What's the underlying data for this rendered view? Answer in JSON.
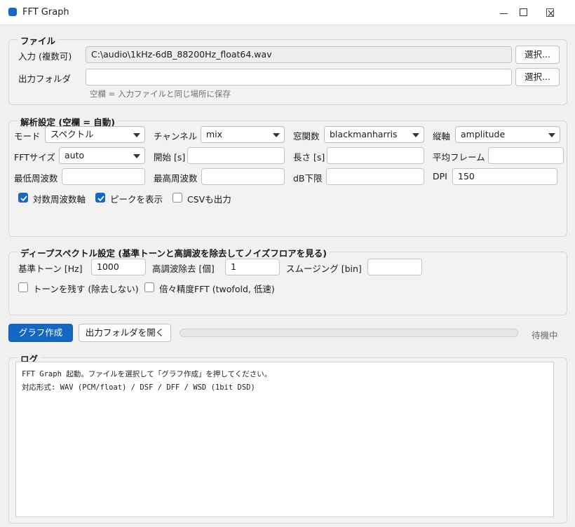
{
  "window": {
    "title": "FFT Graph",
    "controls": {
      "minimize": "minimize-icon",
      "maximize": "maximize-icon",
      "close": "close-icon"
    }
  },
  "file": {
    "title": "ファイル",
    "input_label": "入力 (複数可)",
    "input_value": "C:\\audio\\1kHz-6dB_88200Hz_float64.wav",
    "input_button": "選択...",
    "output_label": "出力フォルダ",
    "output_value": "",
    "output_button": "選択...",
    "hint": "空欄 = 入力ファイルと同じ場所に保存"
  },
  "analysis": {
    "title": "解析設定 (空欄 = 自動)",
    "mode_label": "モード",
    "mode_value": "スペクトル",
    "channel_label": "チャンネル",
    "channel_value": "mix",
    "window_label": "窓関数",
    "window_value": "blackmanharris",
    "yaxis_label": "縦軸",
    "yaxis_value": "amplitude",
    "fft_label": "FFTサイズ",
    "fft_value": "auto",
    "start_label": "開始 [s]",
    "start_value": "",
    "length_label": "長さ [s]",
    "length_value": "",
    "avg_label": "平均フレーム",
    "avg_value": "",
    "minfreq_label": "最低周波数",
    "minfreq_value": "",
    "maxfreq_label": "最高周波数",
    "maxfreq_value": "",
    "dbfloor_label": "dB下限",
    "dbfloor_value": "",
    "dpi_label": "DPI",
    "dpi_value": "150",
    "log_axis": {
      "label": "対数周波数軸",
      "checked": true
    },
    "show_peaks": {
      "label": "ピークを表示",
      "checked": true
    },
    "csv_out": {
      "label": "CSVも出力",
      "checked": false
    }
  },
  "deep": {
    "title": "ディープスペクトル設定 (基準トーンと高調波を除去してノイズフロアを見る)",
    "tone_label": "基準トーン [Hz]",
    "tone_value": "1000",
    "harm_label": "高調波除去 [個]",
    "harm_value": "1",
    "smooth_label": "スムージング [bin]",
    "smooth_value": "",
    "keep_tone": {
      "label": "トーンを残す (除去しない)",
      "checked": false
    },
    "twofold": {
      "label": "倍々精度FFT (twofold, 低速)",
      "checked": false
    }
  },
  "actions": {
    "make_graph": "グラフ作成",
    "open_folder": "出力フォルダを開く",
    "progress": 0,
    "status": "待機中"
  },
  "log": {
    "title": "ログ",
    "lines": [
      "FFT Graph 起動。ファイルを選択して「グラフ作成」を押してください。",
      "対応形式: WAV (PCM/float) / DSF / DFF / WSD (1bit DSD)"
    ]
  },
  "colors": {
    "accent": "#1368c4",
    "background": "#f0f0f0"
  }
}
